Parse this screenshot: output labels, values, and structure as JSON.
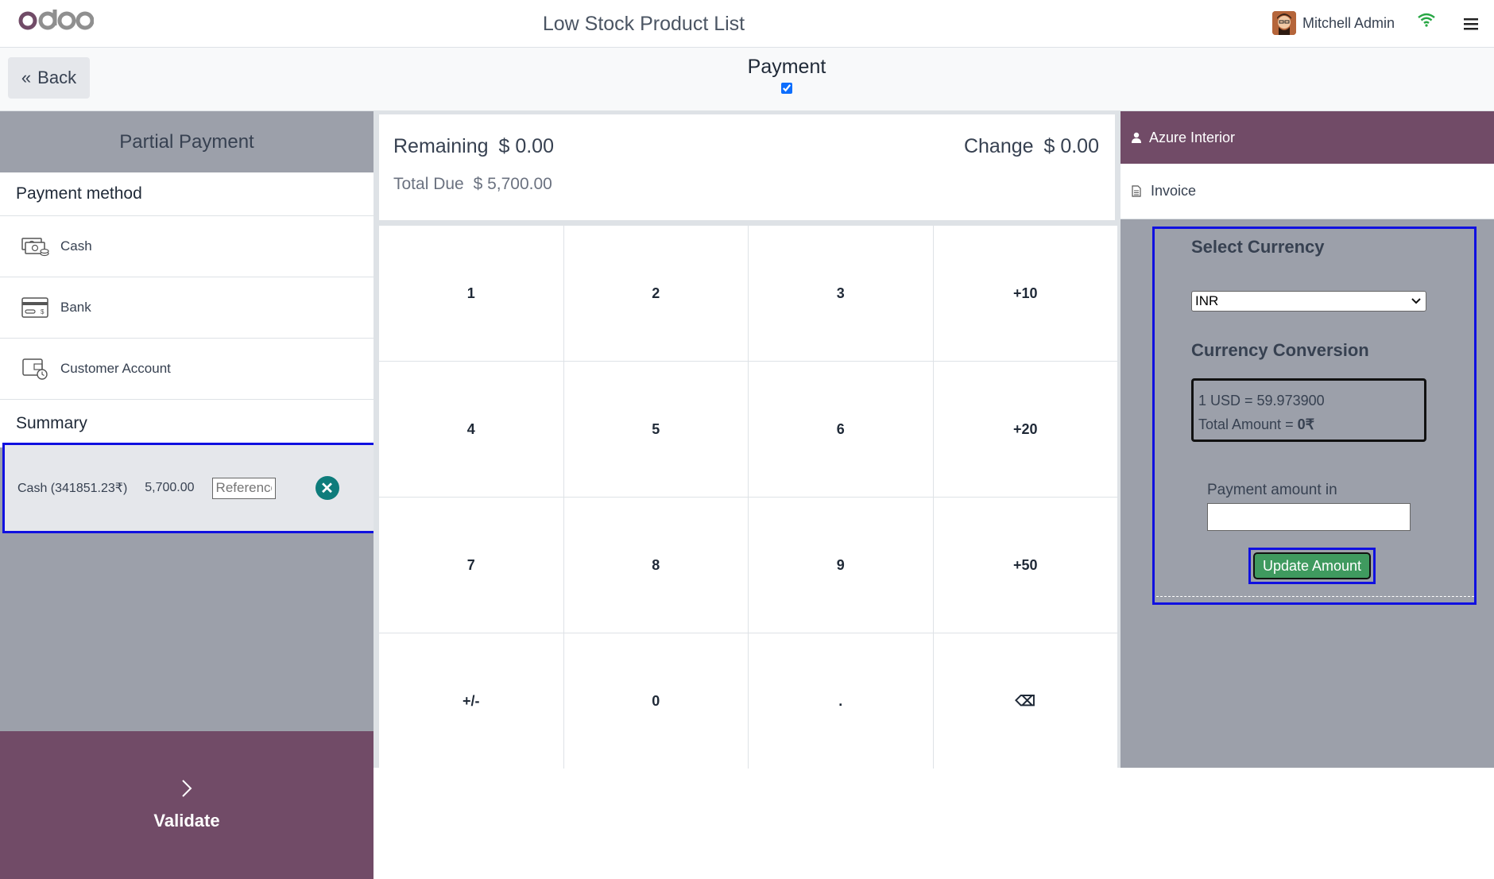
{
  "header": {
    "logo_text": "odoo",
    "title": "Low Stock Product List",
    "user_name": "Mitchell Admin",
    "icons": [
      "avatar",
      "wifi-icon",
      "hamburger-menu-icon"
    ]
  },
  "subbar": {
    "back_label": "Back",
    "title": "Payment",
    "checkbox_checked": true
  },
  "left": {
    "partial_payment": "Partial Payment",
    "payment_method_heading": "Payment method",
    "methods": [
      {
        "label": "Cash",
        "icon": "cash-icon"
      },
      {
        "label": "Bank",
        "icon": "bank-card-icon"
      },
      {
        "label": "Customer Account",
        "icon": "customer-account-icon"
      }
    ],
    "summary_heading": "Summary",
    "payment_line": {
      "name": "Cash (341851.23₹)",
      "amount": "5,700.00",
      "reference_placeholder": "Reference"
    },
    "validate_label": "Validate"
  },
  "status": {
    "remaining_label": "Remaining",
    "remaining_value": "$ 0.00",
    "change_label": "Change",
    "change_value": "$ 0.00",
    "total_due_label": "Total Due",
    "total_due_value": "$ 5,700.00"
  },
  "numpad": [
    "1",
    "2",
    "3",
    "+10",
    "4",
    "5",
    "6",
    "+20",
    "7",
    "8",
    "9",
    "+50",
    "+/-",
    "0",
    ".",
    "⌫"
  ],
  "right": {
    "customer": "Azure Interior",
    "invoice": "Invoice",
    "select_currency_label": "Select Currency",
    "selected_currency": "INR",
    "currency_conversion_label": "Currency Conversion",
    "rate_text": "1 USD = 59.973900",
    "total_amount_label": "Total Amount = ",
    "total_amount_value": "0₹",
    "payment_amount_label": "Payment amount in",
    "update_button": "Update Amount"
  },
  "colors": {
    "brand": "#714b67",
    "panel_grey": "#9ca0aa",
    "highlight_border": "#1010e0",
    "update_button": "#3f9a5f",
    "remove_button": "#0e7c7b"
  }
}
